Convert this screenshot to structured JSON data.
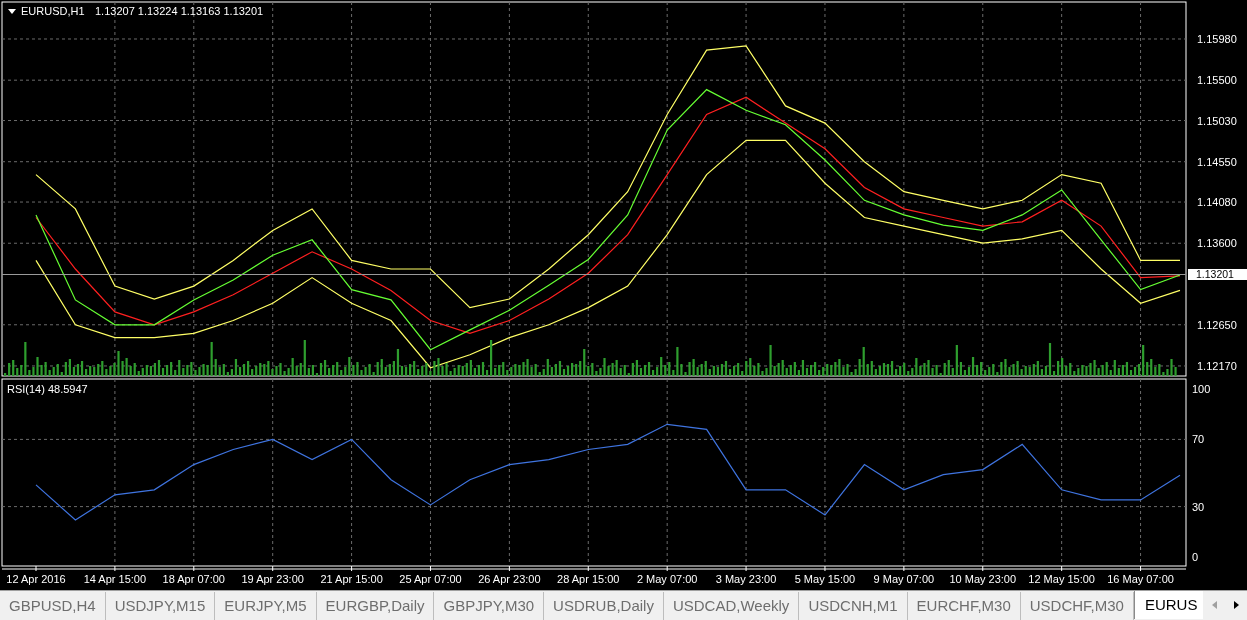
{
  "main_chart": {
    "title": "EURUSD,H1",
    "quote": "1.13207 1.13224 1.13163 1.13201",
    "current_price": "1.13201",
    "chart_data": {
      "type": "line",
      "grid": true,
      "categories": [
        null,
        null,
        null,
        null,
        null,
        null,
        null,
        null,
        null,
        null,
        null,
        null,
        null,
        null,
        null,
        null,
        null,
        null,
        null,
        null,
        null,
        null,
        null,
        null,
        null,
        null,
        null,
        null,
        null,
        null
      ],
      "ylim": [
        1.12053,
        1.16411
      ],
      "yticks": [
        {
          "value": 1.1217,
          "label": "1.12170"
        },
        {
          "value": 1.1265,
          "label": "1.12650"
        },
        {
          "value": 1.136,
          "label": "1.13600"
        },
        {
          "value": 1.1408,
          "label": "1.14080"
        },
        {
          "value": 1.1455,
          "label": "1.14550"
        },
        {
          "value": 1.1503,
          "label": "1.15030"
        },
        {
          "value": 1.155,
          "label": "1.15500"
        },
        {
          "value": 1.1598,
          "label": "1.15980"
        }
      ],
      "series": [
        {
          "color": "#ffff66",
          "values": [
            1.144,
            1.14,
            1.131,
            1.1295,
            1.131,
            1.134,
            1.1375,
            1.14,
            1.134,
            1.133,
            1.133,
            1.1285,
            1.1295,
            1.133,
            1.137,
            1.142,
            1.151,
            1.1585,
            1.159,
            1.152,
            1.15,
            1.1455,
            1.142,
            1.141,
            1.14,
            1.141,
            1.144,
            1.143,
            1.134,
            1.134
          ]
        },
        {
          "color": "#ffff66",
          "values": [
            1.134,
            1.1265,
            1.125,
            1.125,
            1.1255,
            1.127,
            1.129,
            1.132,
            1.129,
            1.127,
            1.1215,
            1.123,
            1.125,
            1.1265,
            1.1285,
            1.131,
            1.137,
            1.144,
            1.148,
            1.148,
            1.143,
            1.139,
            1.138,
            1.137,
            1.136,
            1.1365,
            1.1375,
            1.133,
            1.129,
            1.1305
          ]
        },
        {
          "color": "#ff2020",
          "values": [
            1.139,
            1.133,
            1.128,
            1.1265,
            1.128,
            1.13,
            1.1325,
            1.135,
            1.133,
            1.1305,
            1.127,
            1.1255,
            1.127,
            1.1295,
            1.1325,
            1.137,
            1.144,
            1.151,
            1.153,
            1.15,
            1.147,
            1.1425,
            1.14,
            1.139,
            1.138,
            1.1385,
            1.141,
            1.138,
            1.132,
            1.1322
          ]
        },
        {
          "color": "#66ff33",
          "values": [
            1.1393,
            1.1294,
            1.1265,
            1.1265,
            1.1294,
            1.1317,
            1.1346,
            1.1364,
            1.1306,
            1.1294,
            1.1236,
            1.1259,
            1.1282,
            1.1311,
            1.1341,
            1.1393,
            1.1492,
            1.1539,
            1.1515,
            1.1498,
            1.1457,
            1.141,
            1.1393,
            1.1381,
            1.1375,
            1.1393,
            1.1422,
            1.1364,
            1.1306,
            1.1323
          ]
        }
      ]
    }
  },
  "rsi_chart": {
    "title": "RSI(14) 48.5947",
    "chart_data": {
      "type": "line",
      "grid": true,
      "categories": [
        "12 Apr 2016",
        null,
        "14 Apr 15:00",
        null,
        "18 Apr 07:00",
        null,
        "19 Apr 23:00",
        null,
        "21 Apr 15:00",
        null,
        "25 Apr 07:00",
        null,
        "26 Apr 23:00",
        null,
        "28 Apr 15:00",
        null,
        "2 May 07:00",
        null,
        "3 May 23:00",
        null,
        "5 May 15:00",
        null,
        "9 May 07:00",
        null,
        "10 May 23:00",
        null,
        "12 May 15:00",
        null,
        "16 May 07:00",
        null
      ],
      "ylim": [
        -5.36,
        105.95
      ],
      "yticks": [
        0,
        30,
        70,
        100
      ],
      "series": [
        {
          "color": "#3f74e0",
          "values": [
            42.9,
            22,
            37,
            40,
            55,
            64,
            70,
            58,
            70,
            46,
            31,
            46,
            55,
            58,
            64,
            67,
            79,
            76,
            40,
            40,
            25,
            55,
            40,
            49,
            52,
            67,
            40,
            34,
            34,
            48.6
          ]
        }
      ]
    }
  },
  "tabs": [
    {
      "label": "GBPUSD,H4",
      "selected": false
    },
    {
      "label": "USDJPY,M15",
      "selected": false
    },
    {
      "label": "EURJPY,M5",
      "selected": false
    },
    {
      "label": "EURGBP,Daily",
      "selected": false
    },
    {
      "label": "GBPJPY,M30",
      "selected": false
    },
    {
      "label": "USDRUB,Daily",
      "selected": false
    },
    {
      "label": "USDCAD,Weekly",
      "selected": false
    },
    {
      "label": "USDCNH,M1",
      "selected": false
    },
    {
      "label": "EURCHF,M30",
      "selected": false
    },
    {
      "label": "USDCHF,M30",
      "selected": false
    },
    {
      "label": "EURUS",
      "selected": true
    }
  ],
  "tab_scroll": [
    {
      "kind": "left",
      "disabled": true
    },
    {
      "kind": "right",
      "disabled": false
    }
  ]
}
